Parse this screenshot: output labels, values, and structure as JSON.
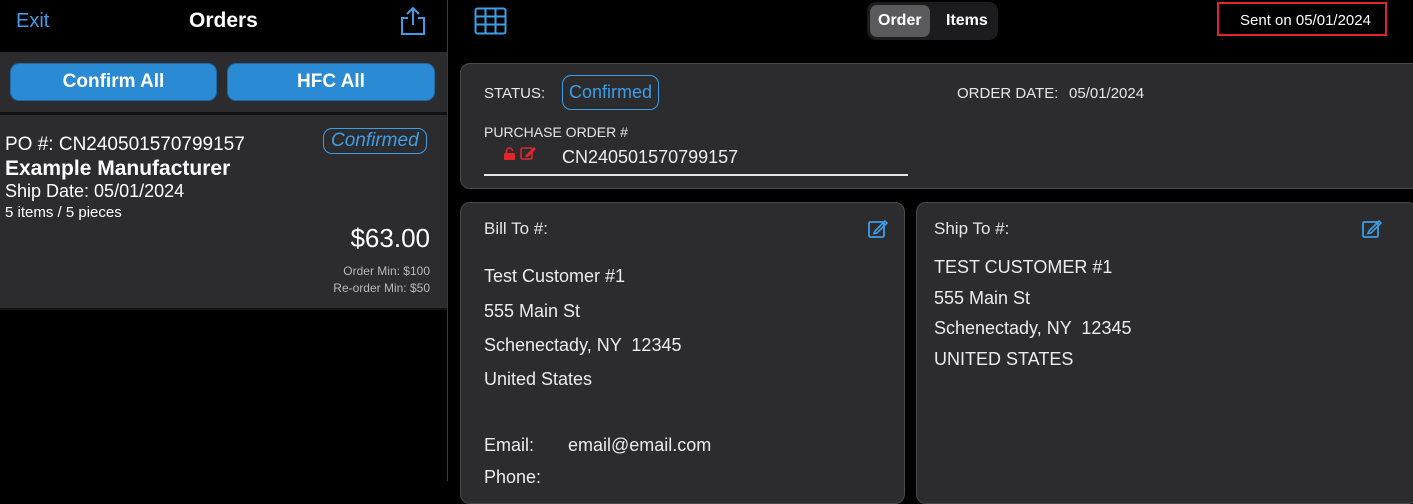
{
  "left_header": {
    "exit_label": "Exit",
    "title": "Orders",
    "share_icon": "share-icon"
  },
  "left_actions": {
    "confirm_all_label": "Confirm All",
    "hfc_all_label": "HFC All"
  },
  "order_card": {
    "po": "PO #: CN240501570799157",
    "status": "Confirmed",
    "manufacturer": "Example Manufacturer",
    "ship_date": "Ship Date: 05/01/2024",
    "items": "5 items / 5 pieces",
    "total": "$63.00",
    "order_min": "Order Min: $100",
    "reorder_min": "Re-order Min: $50"
  },
  "right_header": {
    "grid_icon": "grid-icon",
    "segments": [
      "Order",
      "Items"
    ],
    "selected_segment": "Order",
    "sent_label": "Sent on 05/01/2024",
    "highlight_color": "#e0262b"
  },
  "order_info": {
    "status_label": "STATUS:",
    "status_value": "Confirmed",
    "order_date_label": "ORDER DATE:",
    "order_date_value": "05/01/2024",
    "po_label": "PURCHASE ORDER #",
    "po_value": "CN240501570799157"
  },
  "bill_to": {
    "heading": "Bill To #:",
    "name": "Test Customer #1",
    "street": "555 Main St",
    "city": "Schenectady, NY  12345",
    "country": "United States",
    "email_label": "Email:",
    "email_value": "email@email.com",
    "phone_label": "Phone:"
  },
  "ship_to": {
    "heading": "Ship To #:",
    "name": "TEST CUSTOMER #1",
    "street": "555 Main St",
    "city": "Schenectady, NY  12345",
    "country": "UNITED STATES"
  },
  "colors": {
    "accent": "#2a8bd4",
    "link": "#3d9ee8",
    "panel": "#2c2c2e",
    "lock_red": "#e0262b"
  }
}
